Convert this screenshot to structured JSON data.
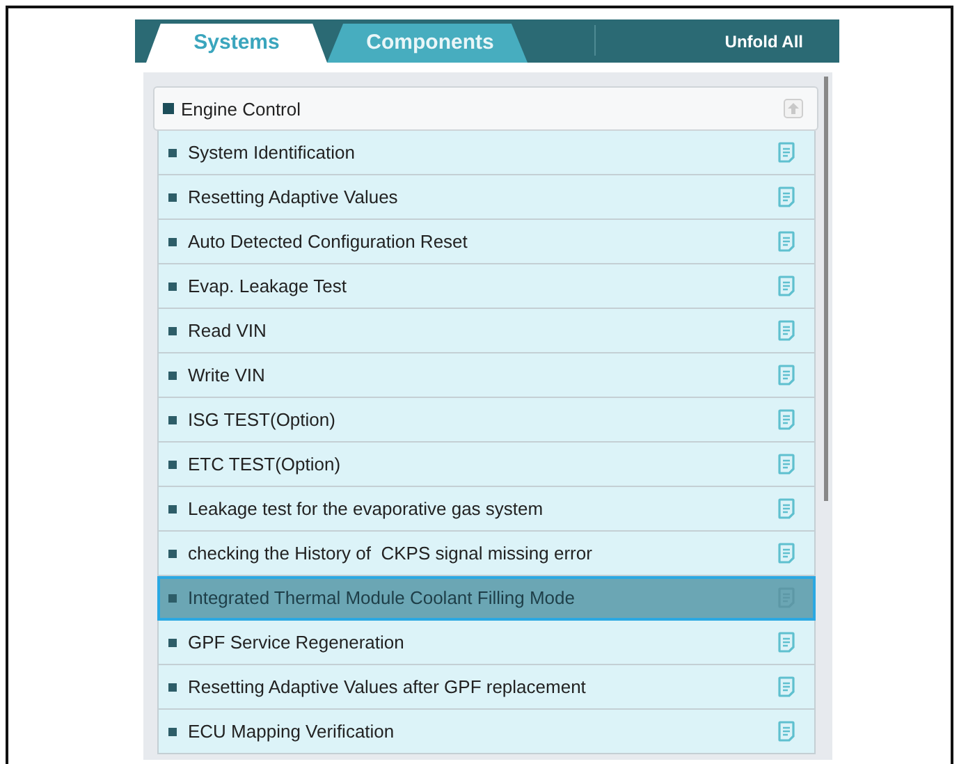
{
  "tabs": [
    {
      "label": "Systems",
      "selected": true
    },
    {
      "label": "Components",
      "selected": false
    }
  ],
  "unfold_button": "Unfold All",
  "group": {
    "title": "Engine Control",
    "expanded": true,
    "items": [
      {
        "label": "System Identification",
        "selected": false
      },
      {
        "label": "Resetting Adaptive Values",
        "selected": false
      },
      {
        "label": "Auto Detected Configuration Reset",
        "selected": false
      },
      {
        "label": "Evap. Leakage Test",
        "selected": false
      },
      {
        "label": "Read VIN",
        "selected": false
      },
      {
        "label": "Write VIN",
        "selected": false
      },
      {
        "label": "ISG TEST(Option)",
        "selected": false
      },
      {
        "label": "ETC TEST(Option)",
        "selected": false
      },
      {
        "label": "Leakage test for the evaporative gas system",
        "selected": false
      },
      {
        "label": "checking the History of  CKPS signal missing error",
        "selected": false
      },
      {
        "label": "Integrated Thermal Module Coolant Filling Mode",
        "selected": true
      },
      {
        "label": "GPF Service Regeneration",
        "selected": false
      },
      {
        "label": "Resetting Adaptive Values after GPF replacement",
        "selected": false
      },
      {
        "label": "ECU Mapping Verification",
        "selected": false
      }
    ]
  }
}
